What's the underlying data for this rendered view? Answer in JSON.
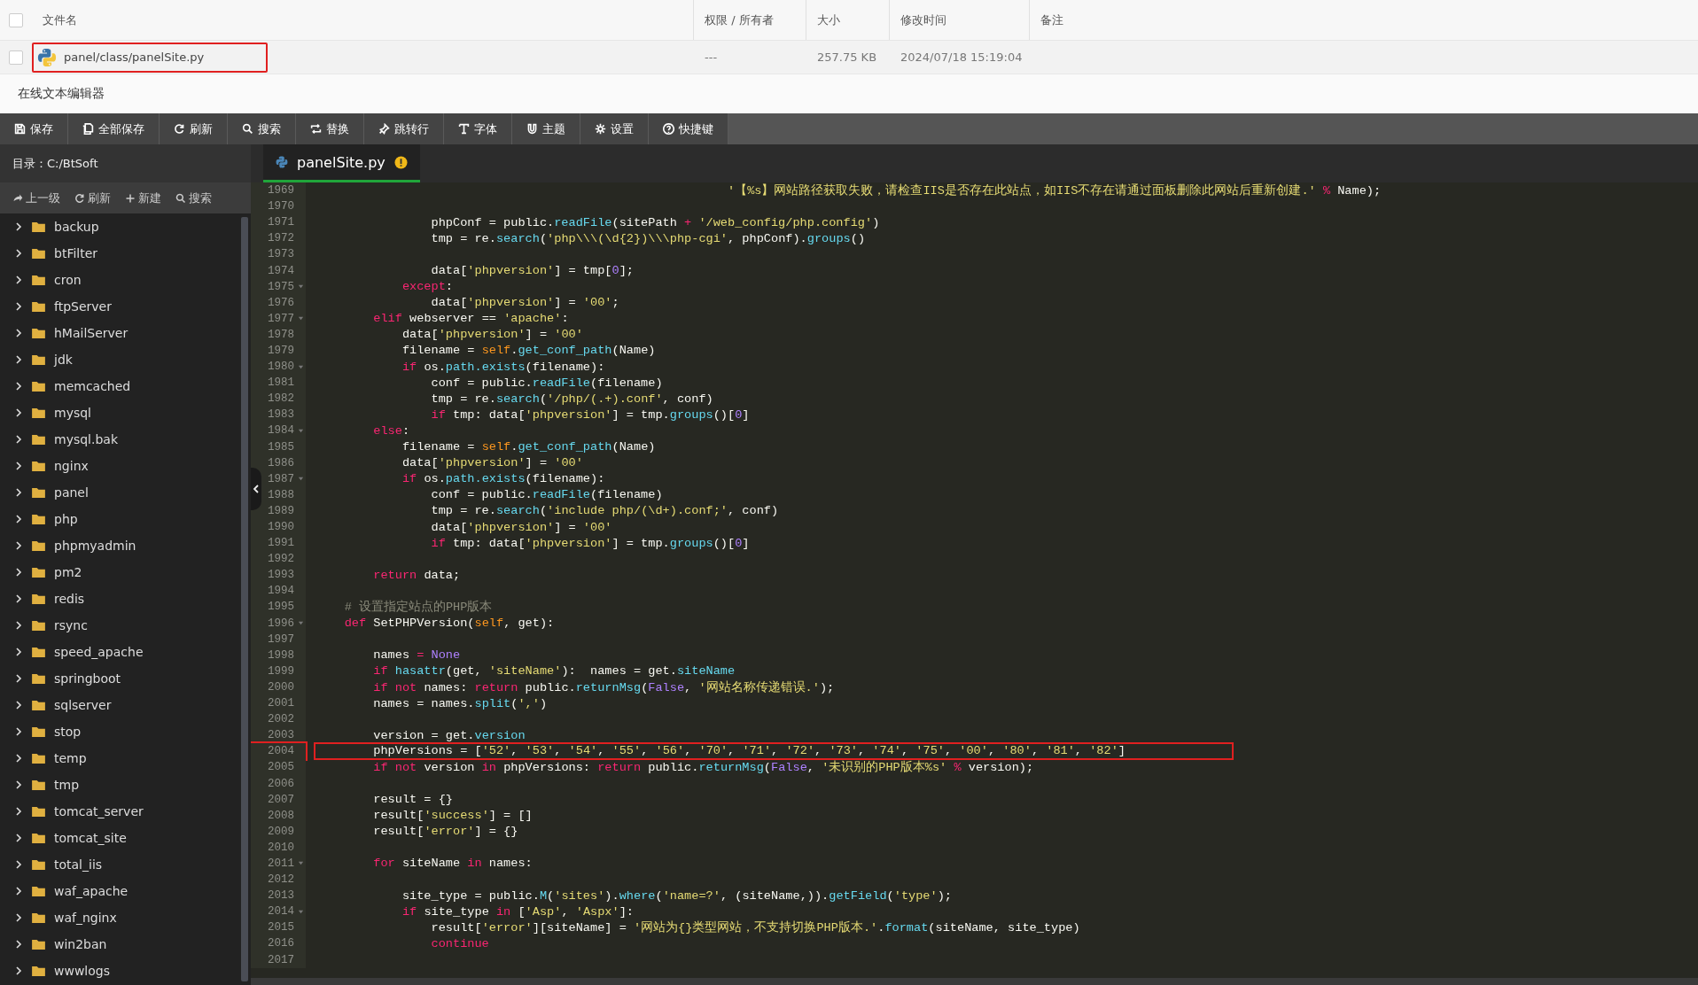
{
  "file_table": {
    "all_checked": false,
    "columns": [
      "文件名",
      "权限 / 所有者",
      "大小",
      "修改时间",
      "备注"
    ],
    "rows": [
      {
        "checked": false,
        "marked": true,
        "name": "panel/class/panelSite.py",
        "permission": "---",
        "size": "257.75 KB",
        "modified": "2024/07/18 15:19:04"
      }
    ]
  },
  "editor_title": "在线文本编辑器",
  "toolbar": [
    "保存",
    "全部保存",
    "刷新",
    "搜索",
    "替换",
    "跳转行",
    "字体",
    "主题",
    "设置",
    "快捷键"
  ],
  "sidebar": {
    "directory": "目录：C:/BtSoft",
    "actions": [
      "上一级",
      "刷新",
      "新建",
      "搜索"
    ],
    "items": [
      {
        "name": "backup",
        "expanded": false
      },
      {
        "name": "btFilter",
        "expanded": false
      },
      {
        "name": "cron",
        "expanded": false
      },
      {
        "name": "ftpServer",
        "expanded": false
      },
      {
        "name": "hMailServer",
        "expanded": false
      },
      {
        "name": "jdk",
        "expanded": false
      },
      {
        "name": "memcached",
        "expanded": false
      },
      {
        "name": "mysql",
        "expanded": false
      },
      {
        "name": "mysql.bak",
        "expanded": false
      },
      {
        "name": "nginx",
        "expanded": false
      },
      {
        "name": "panel",
        "expanded": false
      },
      {
        "name": "php",
        "expanded": false
      },
      {
        "name": "phpmyadmin",
        "expanded": false
      },
      {
        "name": "pm2",
        "expanded": false
      },
      {
        "name": "redis",
        "expanded": false
      },
      {
        "name": "rsync",
        "expanded": false
      },
      {
        "name": "speed_apache",
        "expanded": false
      },
      {
        "name": "springboot",
        "expanded": false
      },
      {
        "name": "sqlserver",
        "expanded": false
      },
      {
        "name": "stop",
        "expanded": false
      },
      {
        "name": "temp",
        "expanded": false
      },
      {
        "name": "tmp",
        "expanded": false
      },
      {
        "name": "tomcat_server",
        "expanded": false
      },
      {
        "name": "tomcat_site",
        "expanded": false
      },
      {
        "name": "total_iis",
        "expanded": false
      },
      {
        "name": "waf_apache",
        "expanded": false
      },
      {
        "name": "waf_nginx",
        "expanded": false
      },
      {
        "name": "win2ban",
        "expanded": false
      },
      {
        "name": "wwwlogs",
        "expanded": false
      }
    ]
  },
  "tabs": [
    {
      "label": "panelSite.py",
      "selected": true,
      "unsaved": true
    }
  ],
  "code": [
    {
      "no": "1969",
      "fold": false,
      "marked": false,
      "tokens": [
        {
          "text": "                                                         '【%s】网站路径获取失败，请检查IIS是否存在此站点，如IIS不存在请通过面板删除此网站后重新创建.'",
          "kind": "string"
        },
        {
          "text": " %",
          "kind": "keyword"
        },
        {
          "text": " Name);",
          "kind": "plain"
        }
      ]
    },
    {
      "no": "1970",
      "fold": false,
      "marked": false
    },
    {
      "no": "1971",
      "fold": false,
      "marked": false,
      "tokens": [
        {
          "text": "                phpConf = public.",
          "kind": "plain"
        },
        {
          "text": "readFile",
          "kind": "call"
        },
        {
          "text": "(sitePath ",
          "kind": "plain"
        },
        {
          "text": "+",
          "kind": "keyword"
        },
        {
          "text": " '/web_config/php.config'",
          "kind": "string"
        },
        {
          "text": ")",
          "kind": "plain"
        }
      ]
    },
    {
      "no": "1972",
      "fold": false,
      "marked": false,
      "tokens": [
        {
          "text": "                tmp = re.",
          "kind": "plain"
        },
        {
          "text": "search",
          "kind": "call"
        },
        {
          "text": "(",
          "kind": "plain"
        },
        {
          "text": "'php\\\\\\(\\d{2})\\\\\\php-cgi'",
          "kind": "string"
        },
        {
          "text": ", phpConf).",
          "kind": "plain"
        },
        {
          "text": "groups",
          "kind": "call"
        },
        {
          "text": "()",
          "kind": "plain"
        }
      ]
    },
    {
      "no": "1973",
      "fold": false,
      "marked": false
    },
    {
      "no": "1974",
      "fold": false,
      "marked": false,
      "tokens": [
        {
          "text": "                data[",
          "kind": "plain"
        },
        {
          "text": "'phpversion'",
          "kind": "string"
        },
        {
          "text": "] = tmp[",
          "kind": "plain"
        },
        {
          "text": "0",
          "kind": "constant"
        },
        {
          "text": "];",
          "kind": "plain"
        }
      ]
    },
    {
      "no": "1975",
      "fold": true,
      "marked": false,
      "tokens": [
        {
          "text": "            except",
          "kind": "keyword"
        },
        {
          "text": ":",
          "kind": "plain"
        }
      ]
    },
    {
      "no": "1976",
      "fold": false,
      "marked": false,
      "tokens": [
        {
          "text": "                data[",
          "kind": "plain"
        },
        {
          "text": "'phpversion'",
          "kind": "string"
        },
        {
          "text": "] = ",
          "kind": "plain"
        },
        {
          "text": "'00'",
          "kind": "string"
        },
        {
          "text": ";",
          "kind": "plain"
        }
      ]
    },
    {
      "no": "1977",
      "fold": true,
      "marked": false,
      "tokens": [
        {
          "text": "        elif",
          "kind": "keyword"
        },
        {
          "text": " webserver == ",
          "kind": "plain"
        },
        {
          "text": "'apache'",
          "kind": "string"
        },
        {
          "text": ":",
          "kind": "plain"
        }
      ]
    },
    {
      "no": "1978",
      "fold": false,
      "marked": false,
      "tokens": [
        {
          "text": "            data[",
          "kind": "plain"
        },
        {
          "text": "'phpversion'",
          "kind": "string"
        },
        {
          "text": "] = ",
          "kind": "plain"
        },
        {
          "text": "'00'",
          "kind": "string"
        }
      ]
    },
    {
      "no": "1979",
      "fold": false,
      "marked": false,
      "tokens": [
        {
          "text": "            filename = ",
          "kind": "plain"
        },
        {
          "text": "self",
          "kind": "self"
        },
        {
          "text": ".",
          "kind": "plain"
        },
        {
          "text": "get_conf_path",
          "kind": "call"
        },
        {
          "text": "(Name)",
          "kind": "plain"
        }
      ]
    },
    {
      "no": "1980",
      "fold": true,
      "marked": false,
      "tokens": [
        {
          "text": "            if",
          "kind": "keyword"
        },
        {
          "text": " os.",
          "kind": "plain"
        },
        {
          "text": "path.exists",
          "kind": "call"
        },
        {
          "text": "(filename):",
          "kind": "plain"
        }
      ]
    },
    {
      "no": "1981",
      "fold": false,
      "marked": false,
      "tokens": [
        {
          "text": "                conf = public.",
          "kind": "plain"
        },
        {
          "text": "readFile",
          "kind": "call"
        },
        {
          "text": "(filename)",
          "kind": "plain"
        }
      ]
    },
    {
      "no": "1982",
      "fold": false,
      "marked": false,
      "tokens": [
        {
          "text": "                tmp = re.",
          "kind": "plain"
        },
        {
          "text": "search",
          "kind": "call"
        },
        {
          "text": "(",
          "kind": "plain"
        },
        {
          "text": "'/php/(.+).conf'",
          "kind": "string"
        },
        {
          "text": ", conf)",
          "kind": "plain"
        }
      ]
    },
    {
      "no": "1983",
      "fold": false,
      "marked": false,
      "tokens": [
        {
          "text": "                if",
          "kind": "keyword"
        },
        {
          "text": " tmp: data[",
          "kind": "plain"
        },
        {
          "text": "'phpversion'",
          "kind": "string"
        },
        {
          "text": "] = tmp.",
          "kind": "plain"
        },
        {
          "text": "groups",
          "kind": "call"
        },
        {
          "text": "()[",
          "kind": "plain"
        },
        {
          "text": "0",
          "kind": "constant"
        },
        {
          "text": "]",
          "kind": "plain"
        }
      ]
    },
    {
      "no": "1984",
      "fold": true,
      "marked": false,
      "tokens": [
        {
          "text": "        else",
          "kind": "keyword"
        },
        {
          "text": ":",
          "kind": "plain"
        }
      ]
    },
    {
      "no": "1985",
      "fold": false,
      "marked": false,
      "tokens": [
        {
          "text": "            filename = ",
          "kind": "plain"
        },
        {
          "text": "self",
          "kind": "self"
        },
        {
          "text": ".",
          "kind": "plain"
        },
        {
          "text": "get_conf_path",
          "kind": "call"
        },
        {
          "text": "(Name)",
          "kind": "plain"
        }
      ]
    },
    {
      "no": "1986",
      "fold": false,
      "marked": false,
      "tokens": [
        {
          "text": "            data[",
          "kind": "plain"
        },
        {
          "text": "'phpversion'",
          "kind": "string"
        },
        {
          "text": "] = ",
          "kind": "plain"
        },
        {
          "text": "'00'",
          "kind": "string"
        }
      ]
    },
    {
      "no": "1987",
      "fold": true,
      "marked": false,
      "tokens": [
        {
          "text": "            if",
          "kind": "keyword"
        },
        {
          "text": " os.",
          "kind": "plain"
        },
        {
          "text": "path.exists",
          "kind": "call"
        },
        {
          "text": "(filename):",
          "kind": "plain"
        }
      ]
    },
    {
      "no": "1988",
      "fold": false,
      "marked": false,
      "tokens": [
        {
          "text": "                conf = public.",
          "kind": "plain"
        },
        {
          "text": "readFile",
          "kind": "call"
        },
        {
          "text": "(filename)",
          "kind": "plain"
        }
      ]
    },
    {
      "no": "1989",
      "fold": false,
      "marked": false,
      "tokens": [
        {
          "text": "                tmp = re.",
          "kind": "plain"
        },
        {
          "text": "search",
          "kind": "call"
        },
        {
          "text": "(",
          "kind": "plain"
        },
        {
          "text": "'include php/(\\d+).conf;'",
          "kind": "string"
        },
        {
          "text": ", conf)",
          "kind": "plain"
        }
      ]
    },
    {
      "no": "1990",
      "fold": false,
      "marked": false,
      "tokens": [
        {
          "text": "                data[",
          "kind": "plain"
        },
        {
          "text": "'phpversion'",
          "kind": "string"
        },
        {
          "text": "] = ",
          "kind": "plain"
        },
        {
          "text": "'00'",
          "kind": "string"
        }
      ]
    },
    {
      "no": "1991",
      "fold": false,
      "marked": false,
      "tokens": [
        {
          "text": "                if",
          "kind": "keyword"
        },
        {
          "text": " tmp: data[",
          "kind": "plain"
        },
        {
          "text": "'phpversion'",
          "kind": "string"
        },
        {
          "text": "] = tmp.",
          "kind": "plain"
        },
        {
          "text": "groups",
          "kind": "call"
        },
        {
          "text": "()[",
          "kind": "plain"
        },
        {
          "text": "0",
          "kind": "constant"
        },
        {
          "text": "]",
          "kind": "plain"
        }
      ]
    },
    {
      "no": "1992",
      "fold": false,
      "marked": false
    },
    {
      "no": "1993",
      "fold": false,
      "marked": false,
      "tokens": [
        {
          "text": "        return",
          "kind": "keyword"
        },
        {
          "text": " data;",
          "kind": "plain"
        }
      ]
    },
    {
      "no": "1994",
      "fold": false,
      "marked": false
    },
    {
      "no": "1995",
      "fold": false,
      "marked": false,
      "tokens": [
        {
          "text": "    # 设置指定站点的PHP版本",
          "kind": "comment"
        }
      ]
    },
    {
      "no": "1996",
      "fold": true,
      "marked": false,
      "tokens": [
        {
          "text": "    def",
          "kind": "keyword"
        },
        {
          "text": " SetPHPVersion(",
          "kind": "plain"
        },
        {
          "text": "self",
          "kind": "self"
        },
        {
          "text": ", get):",
          "kind": "plain"
        }
      ]
    },
    {
      "no": "1997",
      "fold": false,
      "marked": false
    },
    {
      "no": "1998",
      "fold": false,
      "marked": false,
      "tokens": [
        {
          "text": "        names ",
          "kind": "plain"
        },
        {
          "text": "=",
          "kind": "keyword"
        },
        {
          "text": " None",
          "kind": "constant"
        }
      ]
    },
    {
      "no": "1999",
      "fold": false,
      "marked": false,
      "tokens": [
        {
          "text": "        if",
          "kind": "keyword"
        },
        {
          "text": " hasattr",
          "kind": "call"
        },
        {
          "text": "(get, ",
          "kind": "plain"
        },
        {
          "text": "'siteName'",
          "kind": "string"
        },
        {
          "text": "):  names = get.",
          "kind": "plain"
        },
        {
          "text": "siteName",
          "kind": "call"
        }
      ]
    },
    {
      "no": "2000",
      "fold": false,
      "marked": false,
      "tokens": [
        {
          "text": "        if not",
          "kind": "keyword"
        },
        {
          "text": " names: ",
          "kind": "plain"
        },
        {
          "text": "return",
          "kind": "keyword"
        },
        {
          "text": " public.",
          "kind": "plain"
        },
        {
          "text": "returnMsg",
          "kind": "call"
        },
        {
          "text": "(",
          "kind": "plain"
        },
        {
          "text": "False",
          "kind": "constant"
        },
        {
          "text": ", ",
          "kind": "plain"
        },
        {
          "text": "'网站名称传递错误.'",
          "kind": "string"
        },
        {
          "text": ");",
          "kind": "plain"
        }
      ]
    },
    {
      "no": "2001",
      "fold": false,
      "marked": false,
      "tokens": [
        {
          "text": "        names = names.",
          "kind": "plain"
        },
        {
          "text": "split",
          "kind": "call"
        },
        {
          "text": "(",
          "kind": "plain"
        },
        {
          "text": "','",
          "kind": "string"
        },
        {
          "text": ")",
          "kind": "plain"
        }
      ]
    },
    {
      "no": "2002",
      "fold": false,
      "marked": false
    },
    {
      "no": "2003",
      "fold": false,
      "marked": false,
      "tokens": [
        {
          "text": "        version = get.",
          "kind": "plain"
        },
        {
          "text": "version",
          "kind": "call"
        }
      ]
    },
    {
      "no": "2004",
      "fold": false,
      "marked": true,
      "tokens": [
        {
          "text": "        phpVersions = [",
          "kind": "plain"
        },
        {
          "text": "'52'",
          "kind": "string"
        },
        {
          "text": ", ",
          "kind": "plain"
        },
        {
          "text": "'53'",
          "kind": "string"
        },
        {
          "text": ", ",
          "kind": "plain"
        },
        {
          "text": "'54'",
          "kind": "string"
        },
        {
          "text": ", ",
          "kind": "plain"
        },
        {
          "text": "'55'",
          "kind": "string"
        },
        {
          "text": ", ",
          "kind": "plain"
        },
        {
          "text": "'56'",
          "kind": "string"
        },
        {
          "text": ", ",
          "kind": "plain"
        },
        {
          "text": "'70'",
          "kind": "string"
        },
        {
          "text": ", ",
          "kind": "plain"
        },
        {
          "text": "'71'",
          "kind": "string"
        },
        {
          "text": ", ",
          "kind": "plain"
        },
        {
          "text": "'72'",
          "kind": "string"
        },
        {
          "text": ", ",
          "kind": "plain"
        },
        {
          "text": "'73'",
          "kind": "string"
        },
        {
          "text": ", ",
          "kind": "plain"
        },
        {
          "text": "'74'",
          "kind": "string"
        },
        {
          "text": ", ",
          "kind": "plain"
        },
        {
          "text": "'75'",
          "kind": "string"
        },
        {
          "text": ", ",
          "kind": "plain"
        },
        {
          "text": "'00'",
          "kind": "string"
        },
        {
          "text": ", ",
          "kind": "plain"
        },
        {
          "text": "'80'",
          "kind": "string"
        },
        {
          "text": ", ",
          "kind": "plain"
        },
        {
          "text": "'81'",
          "kind": "string"
        },
        {
          "text": ", ",
          "kind": "plain"
        },
        {
          "text": "'82'",
          "kind": "string"
        },
        {
          "text": "]",
          "kind": "plain"
        }
      ]
    },
    {
      "no": "2005",
      "fold": false,
      "marked": false,
      "tokens": [
        {
          "text": "        if not",
          "kind": "keyword"
        },
        {
          "text": " version ",
          "kind": "plain"
        },
        {
          "text": "in",
          "kind": "keyword"
        },
        {
          "text": " phpVersions: ",
          "kind": "plain"
        },
        {
          "text": "return",
          "kind": "keyword"
        },
        {
          "text": " public.",
          "kind": "plain"
        },
        {
          "text": "returnMsg",
          "kind": "call"
        },
        {
          "text": "(",
          "kind": "plain"
        },
        {
          "text": "False",
          "kind": "constant"
        },
        {
          "text": ", ",
          "kind": "plain"
        },
        {
          "text": "'未识别的PHP版本%s'",
          "kind": "string"
        },
        {
          "text": " %",
          "kind": "keyword"
        },
        {
          "text": " version);",
          "kind": "plain"
        }
      ]
    },
    {
      "no": "2006",
      "fold": false,
      "marked": false
    },
    {
      "no": "2007",
      "fold": false,
      "marked": false,
      "tokens": [
        {
          "text": "        result = {}",
          "kind": "plain"
        }
      ]
    },
    {
      "no": "2008",
      "fold": false,
      "marked": false,
      "tokens": [
        {
          "text": "        result[",
          "kind": "plain"
        },
        {
          "text": "'success'",
          "kind": "string"
        },
        {
          "text": "] = []",
          "kind": "plain"
        }
      ]
    },
    {
      "no": "2009",
      "fold": false,
      "marked": false,
      "tokens": [
        {
          "text": "        result[",
          "kind": "plain"
        },
        {
          "text": "'error'",
          "kind": "string"
        },
        {
          "text": "] = {}",
          "kind": "plain"
        }
      ]
    },
    {
      "no": "2010",
      "fold": false,
      "marked": false
    },
    {
      "no": "2011",
      "fold": true,
      "marked": false,
      "tokens": [
        {
          "text": "        for",
          "kind": "keyword"
        },
        {
          "text": " siteName ",
          "kind": "plain"
        },
        {
          "text": "in",
          "kind": "keyword"
        },
        {
          "text": " names:",
          "kind": "plain"
        }
      ]
    },
    {
      "no": "2012",
      "fold": false,
      "marked": false
    },
    {
      "no": "2013",
      "fold": false,
      "marked": false,
      "tokens": [
        {
          "text": "            site_type = public.",
          "kind": "plain"
        },
        {
          "text": "M",
          "kind": "call"
        },
        {
          "text": "(",
          "kind": "plain"
        },
        {
          "text": "'sites'",
          "kind": "string"
        },
        {
          "text": ").",
          "kind": "plain"
        },
        {
          "text": "where",
          "kind": "call"
        },
        {
          "text": "(",
          "kind": "plain"
        },
        {
          "text": "'name=?'",
          "kind": "string"
        },
        {
          "text": ", (siteName,)).",
          "kind": "plain"
        },
        {
          "text": "getField",
          "kind": "call"
        },
        {
          "text": "(",
          "kind": "plain"
        },
        {
          "text": "'type'",
          "kind": "string"
        },
        {
          "text": ");",
          "kind": "plain"
        }
      ]
    },
    {
      "no": "2014",
      "fold": true,
      "marked": false,
      "tokens": [
        {
          "text": "            if",
          "kind": "keyword"
        },
        {
          "text": " site_type ",
          "kind": "plain"
        },
        {
          "text": "in",
          "kind": "keyword"
        },
        {
          "text": " [",
          "kind": "plain"
        },
        {
          "text": "'Asp'",
          "kind": "string"
        },
        {
          "text": ", ",
          "kind": "plain"
        },
        {
          "text": "'Aspx'",
          "kind": "string"
        },
        {
          "text": "]:",
          "kind": "plain"
        }
      ]
    },
    {
      "no": "2015",
      "fold": false,
      "marked": false,
      "tokens": [
        {
          "text": "                result[",
          "kind": "plain"
        },
        {
          "text": "'error'",
          "kind": "string"
        },
        {
          "text": "][siteName] = ",
          "kind": "plain"
        },
        {
          "text": "'网站为{}类型网站，不支持切换PHP版本.'",
          "kind": "string"
        },
        {
          "text": ".",
          "kind": "plain"
        },
        {
          "text": "format",
          "kind": "call"
        },
        {
          "text": "(siteName, site_type)",
          "kind": "plain"
        }
      ]
    },
    {
      "no": "2016",
      "fold": false,
      "marked": false,
      "tokens": [
        {
          "text": "                continue",
          "kind": "keyword"
        }
      ]
    },
    {
      "no": "2017",
      "fold": false,
      "marked": false
    }
  ]
}
